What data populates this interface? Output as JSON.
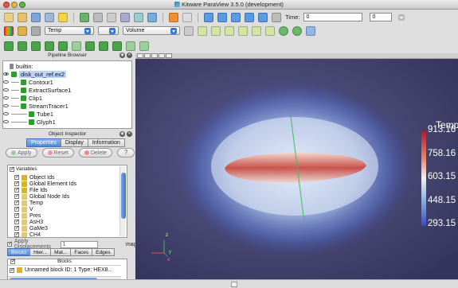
{
  "window": {
    "title": "Kitware ParaView 3.5.0 (development)"
  },
  "toolbar": {
    "time_label": "Time:",
    "time_value": "0",
    "timestep_value": "0",
    "color_by": "Temp",
    "representation": "Volume"
  },
  "pipeline": {
    "title": "Pipeline Browser",
    "items": [
      {
        "label": "builtin:"
      },
      {
        "label": "disk_out_ref.ex2"
      },
      {
        "label": "Contour1"
      },
      {
        "label": "ExtractSurface1"
      },
      {
        "label": "Clip1"
      },
      {
        "label": "StreamTracer1"
      },
      {
        "label": "Tube1"
      },
      {
        "label": "Glyph1"
      }
    ]
  },
  "inspector": {
    "title": "Object Inspector",
    "tabs": [
      "Properties",
      "Display",
      "Information"
    ],
    "apply_label": "Apply",
    "reset_label": "Reset",
    "delete_label": "Delete",
    "help_label": "?",
    "variables_header": "Variables",
    "variables": [
      "Object Ids",
      "Global Element Ids",
      "File Ids",
      "Global Node Ids",
      "Temp",
      "V",
      "Pres",
      "AsH3",
      "GaMe3",
      "CH4"
    ],
    "apply_displacements_label": "Apply Displacements",
    "displacement_value": "1",
    "mag_label": "mag.",
    "block_tabs": [
      "Blocks",
      "Hier...",
      "Mat...",
      "Faces",
      "Edges"
    ],
    "blocks_header": "Blocks",
    "block_row": "Unnamed block ID: 1 Type: HEX8..."
  },
  "colorbar": {
    "title": "Temp",
    "labels": [
      "913.16",
      "758.16",
      "603.15",
      "448.15",
      "293.15"
    ]
  },
  "axes": {
    "x": "x",
    "y": "y",
    "z": "z"
  }
}
